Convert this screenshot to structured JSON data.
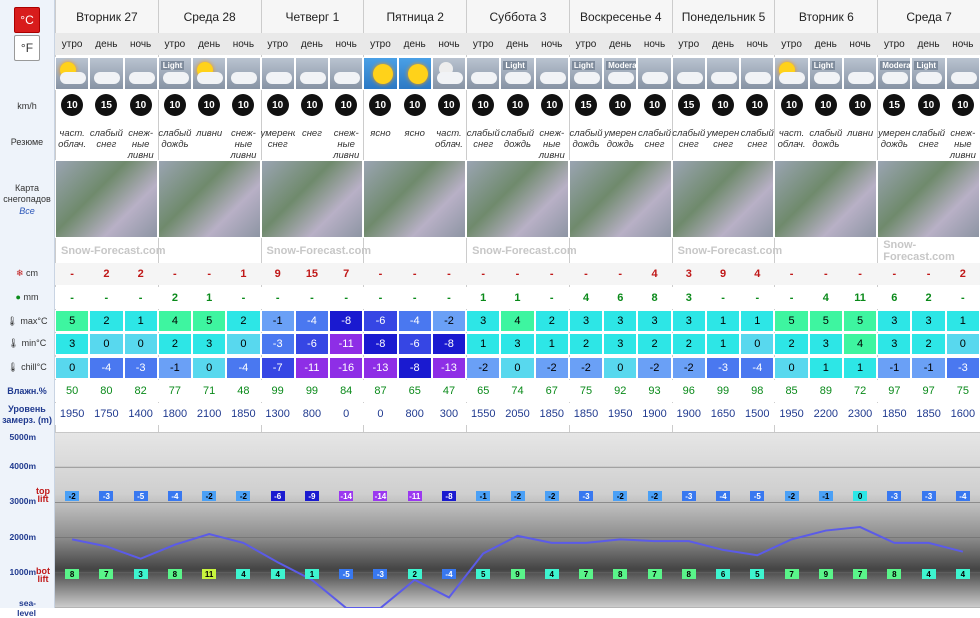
{
  "units": {
    "celsius": "°C",
    "fahrenheit": "°F"
  },
  "labels": {
    "wind": "km/h",
    "summary": "Резюме",
    "snowmap_title": "Карта снегопадов",
    "snowmap_link": "Все",
    "snow": "cm",
    "rain": "mm",
    "max": "max°C",
    "min": "min°C",
    "chill": "chill°C",
    "humidity": "Влажн.%",
    "freezing": "Уровень замерз. (m)",
    "logo": "Snow-Forecast.com"
  },
  "times": [
    "утро",
    "день",
    "ночь"
  ],
  "days": [
    {
      "name": "Вторник 27"
    },
    {
      "name": "Среда 28"
    },
    {
      "name": "Четверг 1"
    },
    {
      "name": "Пятница 2"
    },
    {
      "name": "Суббота 3"
    },
    {
      "name": "Воскресенье 4"
    },
    {
      "name": "Понедельник 5"
    },
    {
      "name": "Вторник 6"
    },
    {
      "name": "Среда 7"
    }
  ],
  "icons": [
    "partly-cloudy",
    "snow",
    "snow-night",
    "light",
    "partly-cloudy",
    "snow-night",
    "snow",
    "snow",
    "snow-night",
    "sun",
    "sun",
    "partly-night",
    "light",
    "snow",
    "snow",
    "light",
    "moderate",
    "snow-night",
    "snow",
    "snow",
    "snow",
    "partly-cloudy",
    "light",
    "rain",
    "moderate",
    "light",
    "snow"
  ],
  "icon_tags": [
    "",
    "",
    "",
    "Light",
    "",
    "",
    "",
    "",
    "",
    "",
    "",
    "",
    "",
    "Light",
    "",
    "Light",
    "Moderate",
    "",
    "",
    "",
    "",
    "",
    "Light",
    "",
    "Moderate",
    "Light",
    ""
  ],
  "wind": [
    10,
    15,
    10,
    10,
    10,
    10,
    10,
    10,
    10,
    10,
    10,
    10,
    10,
    10,
    10,
    15,
    10,
    10,
    15,
    10,
    10,
    10,
    10,
    10,
    15,
    10,
    10
  ],
  "summary": [
    "част. облач.",
    "слабый снег",
    "снеж-ные ливни",
    "слабый дождь",
    "ливни",
    "снеж-ные ливни",
    "умеренсильны снег",
    "снег",
    "снеж-ные ливни",
    "ясно",
    "ясно",
    "част. облач.",
    "слабый снег",
    "слабый дождь",
    "снеж-ные ливни",
    "слабый дождь",
    "умерен дождь",
    "слабый снег",
    "слабый снег",
    "умерен снег",
    "слабый снег",
    "част. облач.",
    "слабый дождь",
    "ливни",
    "умерен дождь",
    "слабый снег",
    "снеж-ные ливни"
  ],
  "snow": [
    "-",
    "2",
    "2",
    "-",
    "-",
    "1",
    "9",
    "15",
    "7",
    "-",
    "-",
    "-",
    "-",
    "-",
    "-",
    "-",
    "-",
    "4",
    "3",
    "9",
    "4",
    "-",
    "-",
    "-",
    "-",
    "-",
    "2"
  ],
  "rain": [
    "-",
    "-",
    "-",
    "2",
    "1",
    "-",
    "-",
    "-",
    "-",
    "-",
    "-",
    "-",
    "1",
    "1",
    "-",
    "4",
    "6",
    "8",
    "3",
    "-",
    "-",
    "-",
    "4",
    "11",
    "6",
    "2",
    "-"
  ],
  "max": [
    "5",
    "2",
    "1",
    "4",
    "5",
    "2",
    "-1",
    "-4",
    "-8",
    "-6",
    "-4",
    "-2",
    "3",
    "4",
    "2",
    "3",
    "3",
    "3",
    "3",
    "1",
    "1",
    "5",
    "5",
    "5",
    "3",
    "3",
    "1"
  ],
  "min": [
    "3",
    "0",
    "0",
    "2",
    "3",
    "0",
    "-3",
    "-6",
    "-11",
    "-8",
    "-6",
    "-8",
    "1",
    "3",
    "1",
    "2",
    "3",
    "2",
    "2",
    "1",
    "0",
    "2",
    "3",
    "4",
    "3",
    "2",
    "0"
  ],
  "chill": [
    "0",
    "-4",
    "-3",
    "-1",
    "0",
    "-4",
    "-7",
    "-11",
    "-16",
    "-13",
    "-8",
    "-13",
    "-2",
    "0",
    "-2",
    "-2",
    "0",
    "-2",
    "-2",
    "-3",
    "-4",
    "0",
    "1",
    "1",
    "-1",
    "-1",
    "-3"
  ],
  "humidity": [
    "50",
    "80",
    "82",
    "77",
    "71",
    "48",
    "99",
    "99",
    "84",
    "87",
    "65",
    "47",
    "65",
    "74",
    "67",
    "75",
    "92",
    "93",
    "96",
    "99",
    "98",
    "85",
    "89",
    "72",
    "97",
    "97",
    "75"
  ],
  "freezing": [
    "1950",
    "1750",
    "1400",
    "1800",
    "2100",
    "1850",
    "1300",
    "800",
    "0",
    "0",
    "800",
    "300",
    "1550",
    "2050",
    "1850",
    "1850",
    "1950",
    "1900",
    "1900",
    "1650",
    "1500",
    "1950",
    "2200",
    "2300",
    "1850",
    "1850",
    "1600"
  ],
  "chart": {
    "altitudes": [
      "5000m",
      "4000m",
      "3000m",
      "2000m",
      "1000m",
      "sea-level"
    ],
    "top_label": "top lift",
    "bot_label": "bot lift",
    "top": [
      "-2",
      "-3",
      "-5",
      "-4",
      "-2",
      "-2",
      "-6",
      "-9",
      "-14",
      "-14",
      "-11",
      "-8",
      "-1",
      "-2",
      "-2",
      "-3",
      "-2",
      "-2",
      "-3",
      "-4",
      "-5",
      "-2",
      "-1",
      "0",
      "-3",
      "-3",
      "-4"
    ],
    "bot": [
      "8",
      "7",
      "3",
      "8",
      "11",
      "4",
      "4",
      "1",
      "-5",
      "-3",
      "2",
      "-4",
      "5",
      "9",
      "4",
      "7",
      "8",
      "7",
      "8",
      "6",
      "5",
      "7",
      "9",
      "7",
      "8",
      "4",
      "4"
    ],
    "colors": {
      "line": "#5b5be8"
    }
  }
}
